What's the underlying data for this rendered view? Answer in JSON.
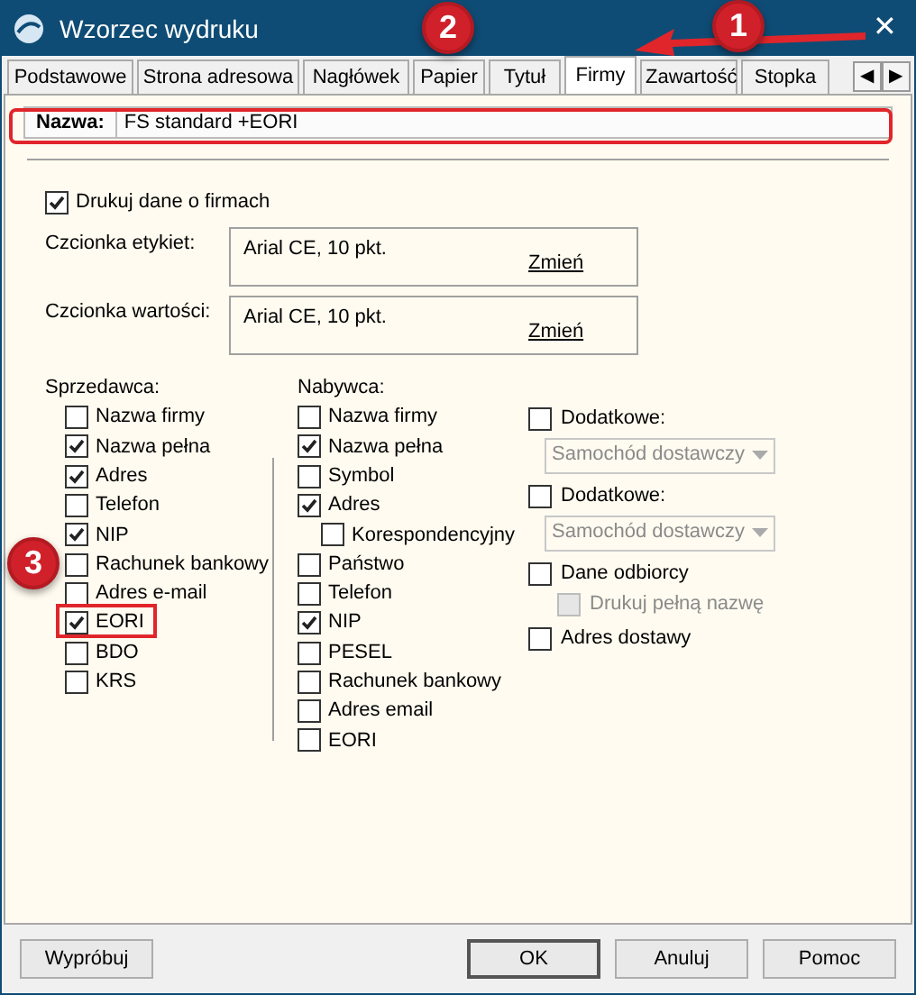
{
  "window": {
    "title": "Wzorzec wydruku",
    "close": "✕"
  },
  "tabs": [
    {
      "label": "Podstawowe",
      "selected": false
    },
    {
      "label": "Strona adresowa",
      "selected": false
    },
    {
      "label": "Nagłówek",
      "selected": false
    },
    {
      "label": "Papier",
      "selected": false
    },
    {
      "label": "Tytuł",
      "selected": false
    },
    {
      "label": "Firmy",
      "selected": true
    },
    {
      "label": "Zawartość",
      "selected": false
    },
    {
      "label": "Stopka",
      "selected": false
    }
  ],
  "tab_scroll": [
    "◀",
    "▶"
  ],
  "name_field": {
    "label": "Nazwa:",
    "value": "FS standard +EORI"
  },
  "print_companies": {
    "label": "Drukuj dane o firmach",
    "checked": true
  },
  "fonts": [
    {
      "label": "Czcionka etykiet:",
      "value": "Arial CE, 10 pkt.",
      "link": "Zmień"
    },
    {
      "label": "Czcionka wartości:",
      "value": "Arial CE, 10 pkt.",
      "link": "Zmień"
    }
  ],
  "seller": {
    "title": "Sprzedawca:",
    "items": [
      {
        "label": "Nazwa firmy",
        "checked": false
      },
      {
        "label": "Nazwa pełna",
        "checked": true
      },
      {
        "label": "Adres",
        "checked": true
      },
      {
        "label": "Telefon",
        "checked": false
      },
      {
        "label": "NIP",
        "checked": true
      },
      {
        "label": "Rachunek bankowy",
        "checked": false
      },
      {
        "label": "Adres e-mail",
        "checked": false
      },
      {
        "label": "EORI",
        "checked": true
      },
      {
        "label": "BDO",
        "checked": false
      },
      {
        "label": "KRS",
        "checked": false
      }
    ]
  },
  "buyer": {
    "title": "Nabywca:",
    "items": [
      {
        "label": "Nazwa firmy",
        "checked": false
      },
      {
        "label": "Nazwa pełna",
        "checked": true
      },
      {
        "label": "Symbol",
        "checked": false
      },
      {
        "label": "Adres",
        "checked": true,
        "children": [
          {
            "label": "Korespondencyjny",
            "checked": false
          }
        ]
      },
      {
        "label": "Państwo",
        "checked": false
      },
      {
        "label": "Telefon",
        "checked": false
      },
      {
        "label": "NIP",
        "checked": true
      },
      {
        "label": "PESEL",
        "checked": false
      },
      {
        "label": "Rachunek bankowy",
        "checked": false
      },
      {
        "label": "Adres email",
        "checked": false
      },
      {
        "label": "EORI",
        "checked": false
      }
    ]
  },
  "extra": [
    {
      "kind": "checkbox",
      "label": "Dodatkowe:",
      "checked": false,
      "disabled": false
    },
    {
      "kind": "dropdown",
      "value": "Samochód dostawczy",
      "disabled": true
    },
    {
      "kind": "checkbox",
      "label": "Dodatkowe:",
      "checked": false,
      "disabled": false
    },
    {
      "kind": "dropdown",
      "value": "Samochód dostawczy",
      "disabled": true
    },
    {
      "kind": "checkbox",
      "label": "Dane odbiorcy",
      "checked": false,
      "disabled": false
    },
    {
      "kind": "subcheckbox",
      "label": "Drukuj pełną nazwę",
      "checked": false,
      "disabled": true
    },
    {
      "kind": "checkbox",
      "label": "Adres dostawy",
      "checked": false,
      "disabled": false
    }
  ],
  "buttons": {
    "left": [
      "Wypróbuj"
    ],
    "right": [
      "OK",
      "Anuluj",
      "Pomoc"
    ]
  },
  "annotations": [
    "1",
    "2",
    "3"
  ]
}
